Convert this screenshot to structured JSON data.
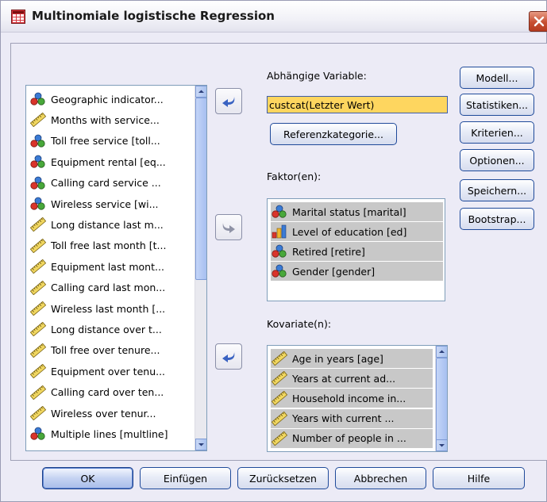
{
  "window": {
    "title": "Multinomiale logistische Regression"
  },
  "colors": {
    "accent": "#3164c5",
    "dependent_field_bg": "#fed65f",
    "selected_row_bg": "#c8c8c8"
  },
  "source_list": {
    "items": [
      {
        "label": "Geographic indicator...",
        "icon": "nominal-icon"
      },
      {
        "label": "Months with service...",
        "icon": "scale-icon"
      },
      {
        "label": "Toll free service [toll...",
        "icon": "nominal-icon"
      },
      {
        "label": "Equipment rental [eq...",
        "icon": "nominal-icon"
      },
      {
        "label": "Calling card service ...",
        "icon": "nominal-icon"
      },
      {
        "label": "Wireless service [wi...",
        "icon": "nominal-icon"
      },
      {
        "label": "Long distance last m...",
        "icon": "scale-icon"
      },
      {
        "label": "Toll free last month [t...",
        "icon": "scale-icon"
      },
      {
        "label": "Equipment last mont...",
        "icon": "scale-icon"
      },
      {
        "label": "Calling card last mon...",
        "icon": "scale-icon"
      },
      {
        "label": "Wireless last month [...",
        "icon": "scale-icon"
      },
      {
        "label": "Long distance over t...",
        "icon": "scale-icon"
      },
      {
        "label": "Toll free over tenure...",
        "icon": "scale-icon"
      },
      {
        "label": "Equipment over tenu...",
        "icon": "scale-icon"
      },
      {
        "label": "Calling card over ten...",
        "icon": "scale-icon"
      },
      {
        "label": "Wireless over tenur...",
        "icon": "scale-icon"
      },
      {
        "label": "Multiple lines [multline]",
        "icon": "nominal-icon"
      }
    ]
  },
  "dependent": {
    "label": "Abhängige Variable:",
    "value": "custcat(Letzter Wert)",
    "reference_button": "Referenzkategorie..."
  },
  "factors": {
    "label": "Faktor(en):",
    "items": [
      {
        "label": "Marital status [marital]",
        "icon": "nominal-icon"
      },
      {
        "label": "Level of education [ed]",
        "icon": "ordinal-icon"
      },
      {
        "label": "Retired [retire]",
        "icon": "nominal-icon"
      },
      {
        "label": "Gender [gender]",
        "icon": "nominal-icon"
      }
    ]
  },
  "covariates": {
    "label": "Kovariate(n):",
    "items": [
      {
        "label": "Age in years [age]",
        "icon": "scale-icon"
      },
      {
        "label": "Years at current ad...",
        "icon": "scale-icon"
      },
      {
        "label": "Household income in...",
        "icon": "scale-icon"
      },
      {
        "label": "Years with current ...",
        "icon": "scale-icon"
      },
      {
        "label": "Number of people in ...",
        "icon": "scale-icon"
      }
    ]
  },
  "side_buttons": {
    "modell": "Modell...",
    "statistiken": "Statistiken...",
    "kriterien": "Kriterien...",
    "optionen": "Optionen...",
    "speichern": "Speichern...",
    "bootstrap": "Bootstrap..."
  },
  "footer_buttons": {
    "ok": "OK",
    "einfuegen": "Einfügen",
    "zuruecksetzen": "Zurücksetzen",
    "abbrechen": "Abbrechen",
    "hilfe": "Hilfe"
  }
}
